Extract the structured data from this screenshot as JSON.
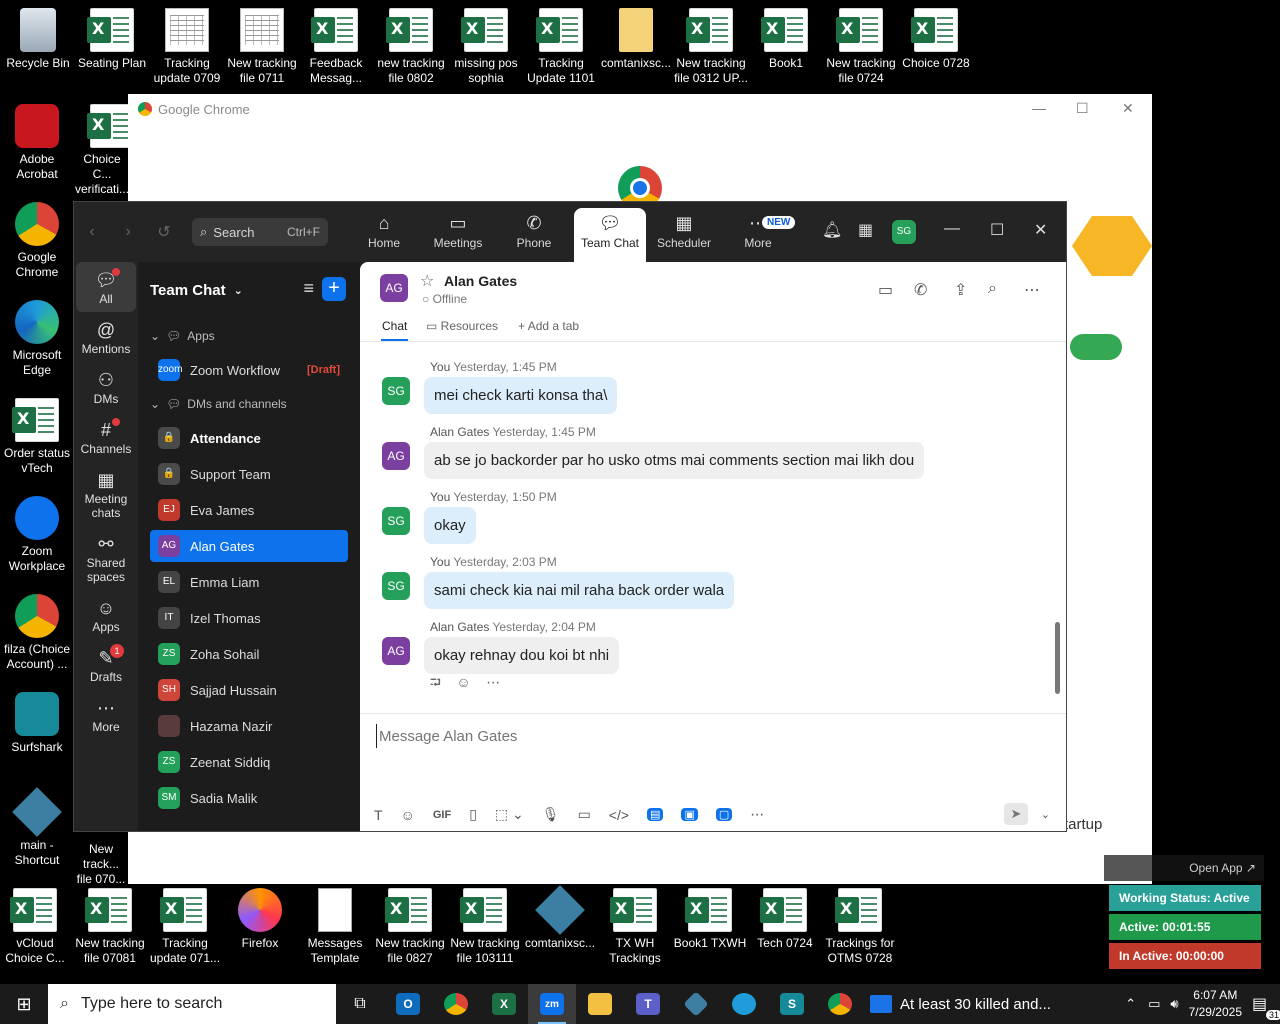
{
  "desktop": {
    "top_icons": [
      {
        "label": "Recycle Bin",
        "icon": "recycle-bin"
      },
      {
        "label": "Seating Plan",
        "icon": "excel"
      },
      {
        "label": "Tracking update 0709",
        "icon": "sheet"
      },
      {
        "label": "New tracking file 0711",
        "icon": "sheet"
      },
      {
        "label": "Feedback Messag...",
        "icon": "excel"
      },
      {
        "label": "new tracking file 0802",
        "icon": "excel"
      },
      {
        "label": "missing pos sophia",
        "icon": "excel"
      },
      {
        "label": "Tracking Update 1101",
        "icon": "excel"
      },
      {
        "label": "comtanixsc...",
        "icon": "zip-folder"
      },
      {
        "label": "New tracking file 0312 UP...",
        "icon": "excel"
      },
      {
        "label": "Book1",
        "icon": "excel"
      },
      {
        "label": "New tracking file 0724",
        "icon": "excel"
      },
      {
        "label": "Choice 0728",
        "icon": "excel"
      }
    ],
    "left_icons": [
      {
        "label": "Adobe Acrobat",
        "icon": "acrobat"
      },
      {
        "label": "Google Chrome",
        "icon": "chrome"
      },
      {
        "label": "Microsoft Edge",
        "icon": "edge"
      },
      {
        "label": "Order status vTech",
        "icon": "excel"
      },
      {
        "label": "Zoom Workplace",
        "icon": "zoom"
      },
      {
        "label": "filza (Choice Account) ...",
        "icon": "chrome"
      },
      {
        "label": "Surfshark",
        "icon": "surfshark"
      },
      {
        "label": "main - Shortcut",
        "icon": "app"
      }
    ],
    "partial_icons": [
      {
        "label": "Choice C... verificati..."
      },
      {
        "label": "New track... file 070..."
      }
    ],
    "bottom_icons": [
      {
        "label": "vCloud Choice C...",
        "icon": "excel"
      },
      {
        "label": "New tracking file 07081",
        "icon": "excel"
      },
      {
        "label": "Tracking update 071...",
        "icon": "excel"
      },
      {
        "label": "Firefox",
        "icon": "firefox"
      },
      {
        "label": "Messages Template",
        "icon": "document"
      },
      {
        "label": "New tracking file 0827",
        "icon": "excel"
      },
      {
        "label": "New tracking file 103111",
        "icon": "excel"
      },
      {
        "label": "comtanixsc...",
        "icon": "app"
      },
      {
        "label": "TX WH Trackings",
        "icon": "excel"
      },
      {
        "label": "Book1 TXWH",
        "icon": "excel"
      },
      {
        "label": "Tech 0724",
        "icon": "excel"
      },
      {
        "label": "Trackings for OTMS 0728",
        "icon": "excel"
      }
    ]
  },
  "chrome_window": {
    "title": "Google Chrome",
    "background_text": "tartup"
  },
  "zoom": {
    "search": {
      "label": "Search",
      "shortcut": "Ctrl+F"
    },
    "top_tabs": [
      {
        "label": "Home",
        "icon": "home-icon"
      },
      {
        "label": "Meetings",
        "icon": "video-icon"
      },
      {
        "label": "Phone",
        "icon": "phone-icon"
      },
      {
        "label": "Team Chat",
        "icon": "chat-icon",
        "active": true
      },
      {
        "label": "Scheduler",
        "icon": "calendar-icon"
      },
      {
        "label": "More",
        "icon": "more-icon",
        "badge": "NEW"
      }
    ],
    "user_initials": "SG",
    "rail": [
      {
        "label": "All",
        "icon": "chat-bubble-icon"
      },
      {
        "label": "Mentions",
        "icon": "at-icon"
      },
      {
        "label": "DMs",
        "icon": "people-icon"
      },
      {
        "label": "Channels",
        "icon": "hash-icon"
      },
      {
        "label": "Meeting chats",
        "icon": "calendar-icon"
      },
      {
        "label": "Shared spaces",
        "icon": "share-icon"
      },
      {
        "label": "Apps",
        "icon": "apps-icon"
      },
      {
        "label": "Drafts",
        "icon": "draft-icon",
        "count": "1"
      },
      {
        "label": "More",
        "icon": "ellipsis-icon"
      }
    ],
    "sidebar": {
      "title": "Team Chat",
      "sections": {
        "apps": "Apps",
        "dms": "DMs and channels"
      },
      "apps_items": [
        {
          "name": "Zoom Workflow",
          "initials": "zoom",
          "color": "#0e72ed",
          "draft": "[Draft]"
        }
      ],
      "dm_items": [
        {
          "name": "Attendance",
          "initials": "🔒",
          "color": "#4a4a4a",
          "bold": true
        },
        {
          "name": "Support Team",
          "initials": "🔒",
          "color": "#4a4a4a"
        },
        {
          "name": "Eva James",
          "initials": "EJ",
          "color": "#c0392b"
        },
        {
          "name": "Alan Gates",
          "initials": "AG",
          "color": "#7b3fa0",
          "active": true
        },
        {
          "name": "Emma Liam",
          "initials": "EL",
          "color": "#444"
        },
        {
          "name": "Izel Thomas",
          "initials": "IT",
          "color": "#444"
        },
        {
          "name": "Zoha Sohail",
          "initials": "ZS",
          "color": "#23a05a"
        },
        {
          "name": "Sajjad Hussain",
          "initials": "SH",
          "color": "#d0453a"
        },
        {
          "name": "Hazama Nazir",
          "initials": "",
          "color": "#5a3b3b"
        },
        {
          "name": "Zeenat Siddiq",
          "initials": "ZS",
          "color": "#23a05a"
        },
        {
          "name": "Sadia Malik",
          "initials": "SM",
          "color": "#23a05a"
        }
      ]
    },
    "chat": {
      "contact": {
        "name": "Alan Gates",
        "initials": "AG",
        "status": "Offline"
      },
      "tabs": [
        "Chat",
        "Resources",
        "Add a tab"
      ],
      "messages": [
        {
          "sender": "You",
          "initials": "SG",
          "time": "Yesterday, 1:45 PM",
          "text": "mei check karti konsa tha\\",
          "me": true
        },
        {
          "sender": "Alan Gates",
          "initials": "AG",
          "time": "Yesterday, 1:45 PM",
          "text": "ab se jo backorder par ho usko otms mai comments section mai likh dou",
          "me": false
        },
        {
          "sender": "You",
          "initials": "SG",
          "time": "Yesterday, 1:50 PM",
          "text": "okay",
          "me": true
        },
        {
          "sender": "You",
          "initials": "SG",
          "time": "Yesterday, 2:03 PM",
          "text": "sami check kia nai mil raha back order wala",
          "me": true
        },
        {
          "sender": "Alan Gates",
          "initials": "AG",
          "time": "Yesterday, 2:04 PM",
          "text": "okay rehnay dou koi bt nhi",
          "me": false
        }
      ],
      "composer_placeholder": "Message Alan Gates",
      "gif_label": "GIF"
    }
  },
  "status_widget": {
    "open_app": "Open App ↗",
    "working": "Working Status: Active",
    "active": "Active: 00:01:55",
    "inactive": "In Active: 00:00:00",
    "colors": {
      "working": "#2aa198",
      "active": "#1e9a4a",
      "inactive": "#c0392b"
    }
  },
  "taskbar": {
    "search_placeholder": "Type here to search",
    "news": "At least 30 killed and...",
    "time": "6:07 AM",
    "date": "7/29/2025",
    "notifications": "31"
  }
}
